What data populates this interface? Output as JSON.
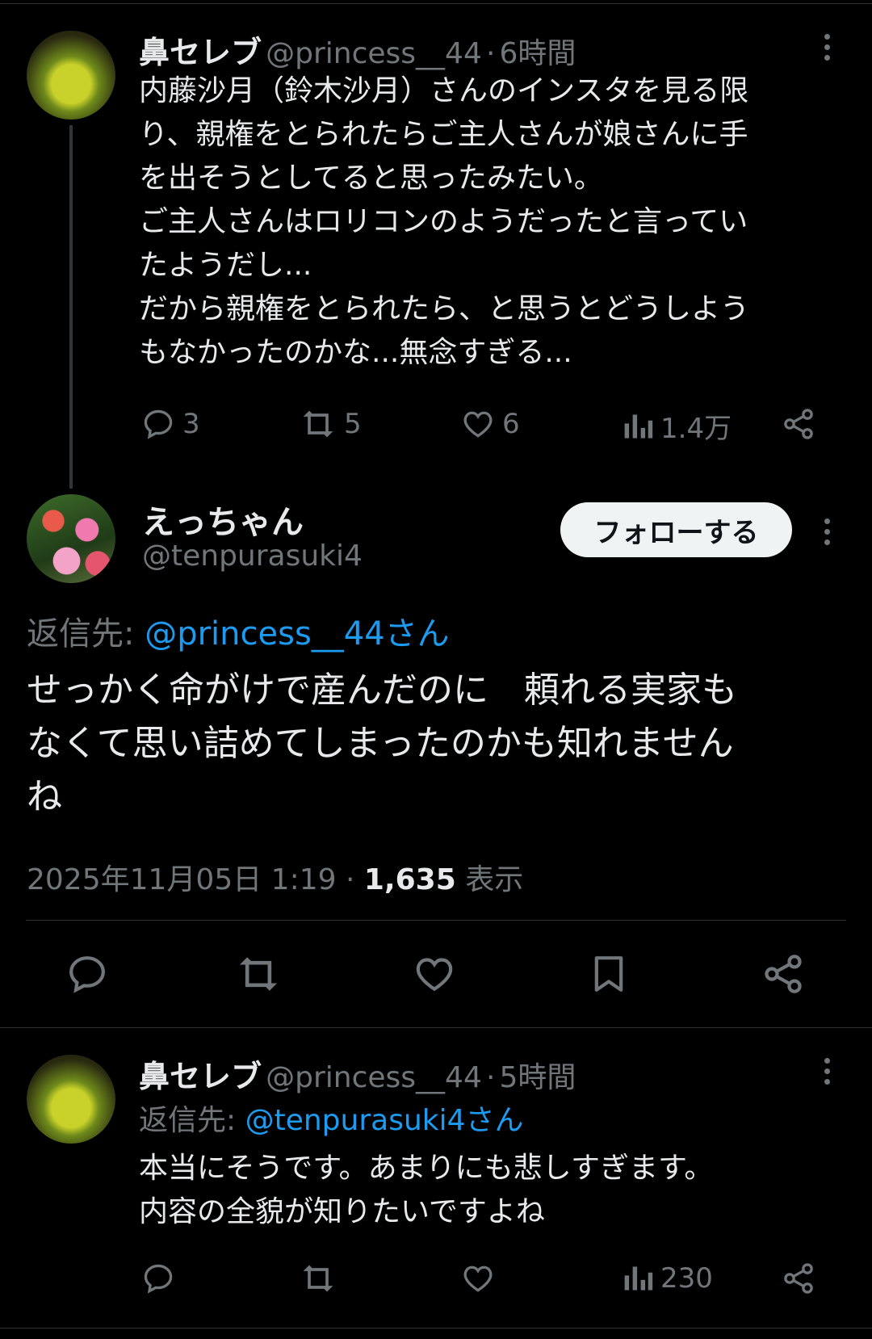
{
  "tweet1": {
    "name": "鼻セレブ",
    "handle": "@princess__44",
    "sep": "·",
    "time": "6時間",
    "text": "内藤沙月（鈴木沙月）さんのインスタを見る限\nり、親権をとられたらご主人さんが娘さんに手\nを出そうとしてると思ったみたい。\nご主人さんはロリコンのようだったと言ってい\nたようだし...\nだから親権をとられたら、と思うとどうしよう\nもなかったのかな...無念すぎる...",
    "replies": "3",
    "retweets": "5",
    "likes": "6",
    "views": "1.4万"
  },
  "tweet2": {
    "name": "えっちゃん",
    "handle": "@tenpurasuki4",
    "follow_label": "フォローする",
    "reply_to_label": "返信先:",
    "reply_to_user": "@princess__44さん",
    "text": "せっかく命がけで産んだのに　頼れる実家も\nなくて思い詰めてしまったのかも知れません\nね",
    "date": "2025年11月05日 1:19",
    "sep": "·",
    "views_count": "1,635",
    "views_label": "表示"
  },
  "tweet3": {
    "name": "鼻セレブ",
    "handle": "@princess__44",
    "sep": "·",
    "time": "5時間",
    "reply_to_label": "返信先:",
    "reply_to_user": "@tenpurasuki4さん",
    "text": "本当にそうです。あまりにも悲しすぎます。\n内容の全貌が知りたいですよね",
    "views": "230"
  },
  "colors": {
    "accent": "#1d9bf0",
    "muted": "#71767b",
    "text": "#e7e9ea",
    "bg": "#000000"
  }
}
